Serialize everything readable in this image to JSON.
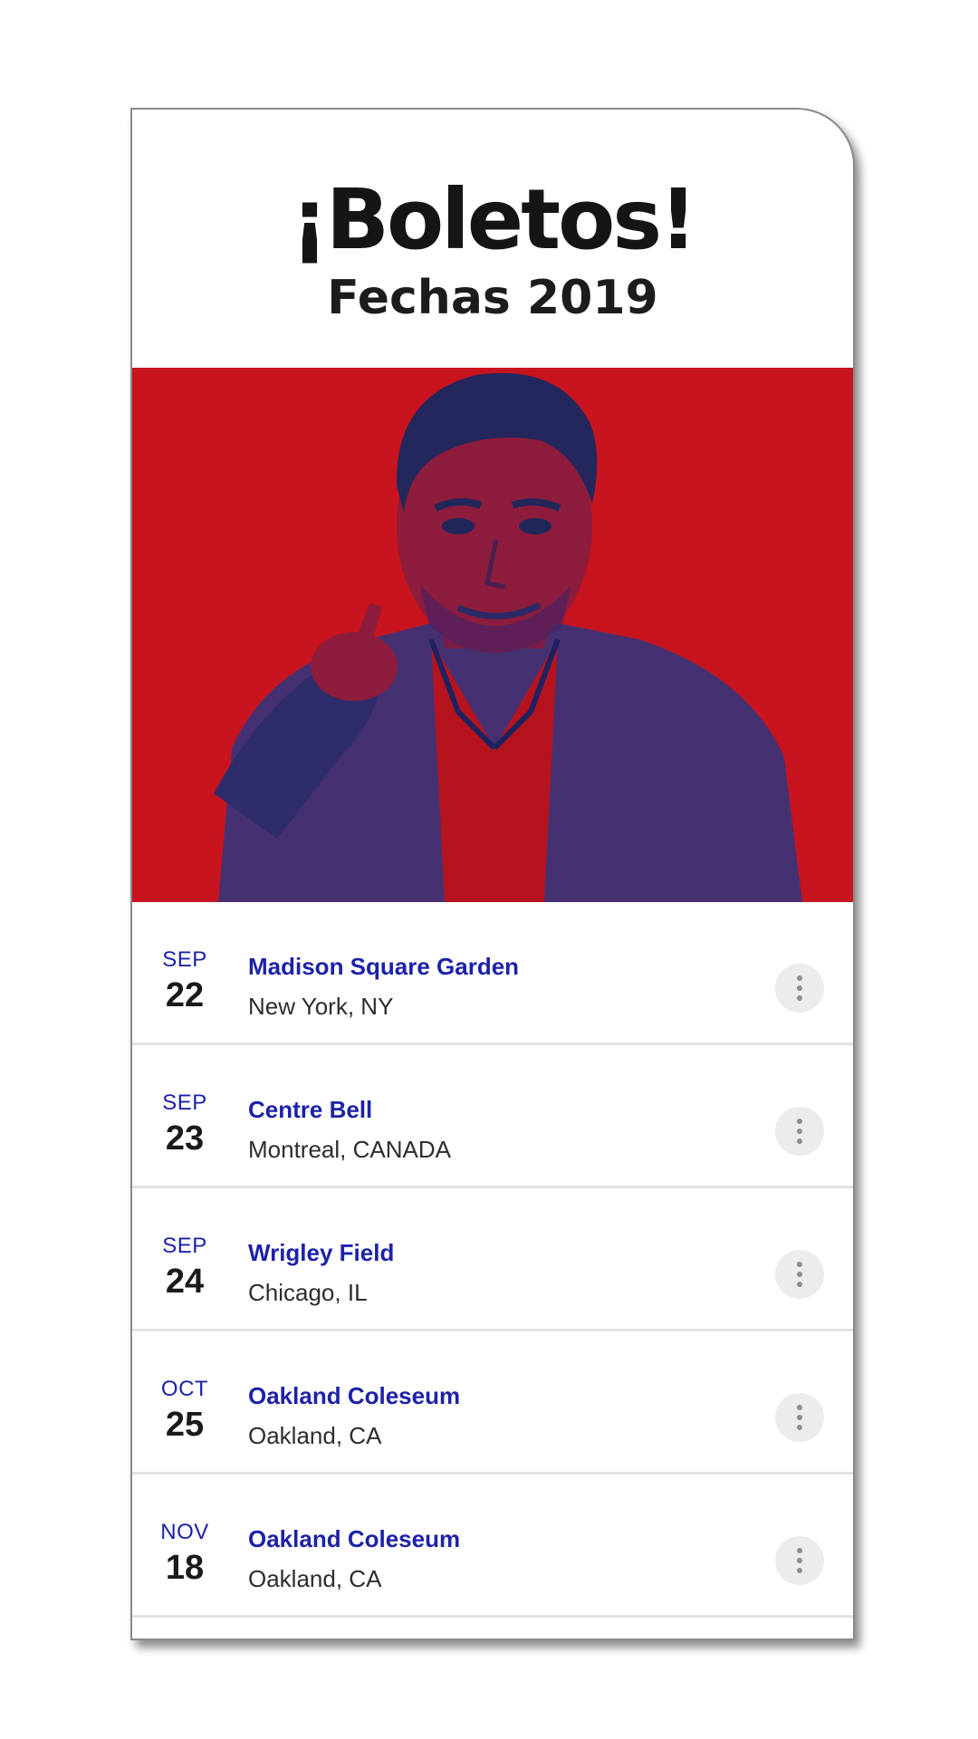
{
  "header": {
    "title": "¡Boletos!",
    "subtitle": "Fechas 2019"
  },
  "hero": {
    "background_color": "#c8141f",
    "duotone_color": "#2a2f7a"
  },
  "events": [
    {
      "month": "SEP",
      "day": "22",
      "venue": "Madison Square Garden",
      "city": "New York, NY"
    },
    {
      "month": "SEP",
      "day": "23",
      "venue": "Centre Bell",
      "city": "Montreal, CANADA"
    },
    {
      "month": "SEP",
      "day": "24",
      "venue": "Wrigley Field",
      "city": "Chicago, IL"
    },
    {
      "month": "OCT",
      "day": "25",
      "venue": "Oakland Coleseum",
      "city": "Oakland, CA"
    },
    {
      "month": "NOV",
      "day": "18",
      "venue": "Oakland Coleseum",
      "city": "Oakland, CA"
    }
  ],
  "icons": {
    "more_options": "more-vertical-icon"
  },
  "colors": {
    "accent": "#1d22a8",
    "hero_red": "#c8141f",
    "divider": "#e3e3e6"
  }
}
